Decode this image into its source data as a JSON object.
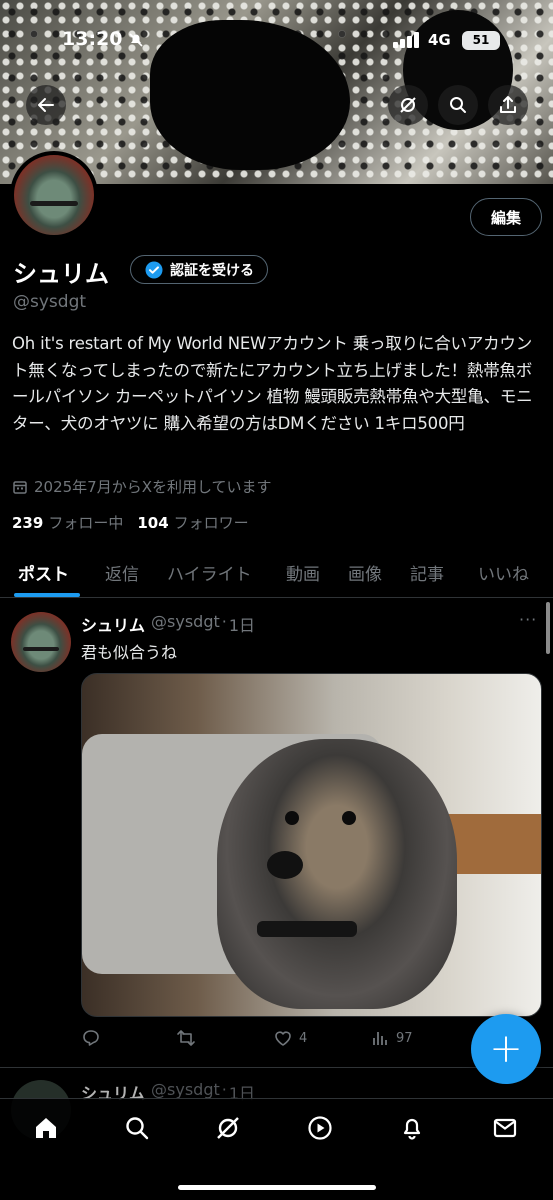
{
  "status_bar": {
    "time": "13:20",
    "network": "4G",
    "battery": "51"
  },
  "header": {
    "back": "back",
    "grok": "grok",
    "search": "search",
    "share": "share"
  },
  "profile": {
    "name": "シュリム",
    "handle": "@sysdgt",
    "edit_label": "編集",
    "verify_label": "認証を受ける",
    "bio": "Oh it's restart of My World NEWアカウント 乗っ取りに合いアカウント無くなってしまったので新たにアカウント立ち上げました！熱帯魚ボールパイソン カーペットパイソン 植物 鰻頭販売熱帯魚や大型亀、モニター、犬のオヤツに 購入希望の方はDMください 1キロ500円",
    "joined": "2025年7月からXを利用しています",
    "following_count": "239",
    "following_label": "フォロー中",
    "followers_count": "104",
    "followers_label": "フォロワー"
  },
  "tabs": [
    {
      "label": "ポスト",
      "active": true
    },
    {
      "label": "返信"
    },
    {
      "label": "ハイライト"
    },
    {
      "label": "動画"
    },
    {
      "label": "画像"
    },
    {
      "label": "記事"
    },
    {
      "label": "いいね"
    }
  ],
  "post": {
    "author": "シュリム",
    "handle": "@sysdgt",
    "sep": "·",
    "time": "1日",
    "more": "···",
    "text": "君も似合うね",
    "likes": "4",
    "views": "97"
  },
  "post2": {
    "author": "シュリム",
    "handle": "@sysdgt",
    "sep": "·",
    "time": "1日"
  },
  "fab_label": "+",
  "colors": {
    "accent": "#1d9bf0",
    "background": "#000000",
    "secondary_text": "#71767b",
    "border": "#2f3336"
  },
  "icons": {
    "header": [
      "back-arrow-icon",
      "grok-icon",
      "search-icon",
      "share-icon"
    ],
    "post_actions": [
      "reply-icon",
      "repost-icon",
      "like-icon",
      "views-icon"
    ],
    "bottom_nav": [
      "home-icon",
      "search-icon",
      "grok-icon",
      "video-icon",
      "bell-icon",
      "mail-icon"
    ]
  }
}
